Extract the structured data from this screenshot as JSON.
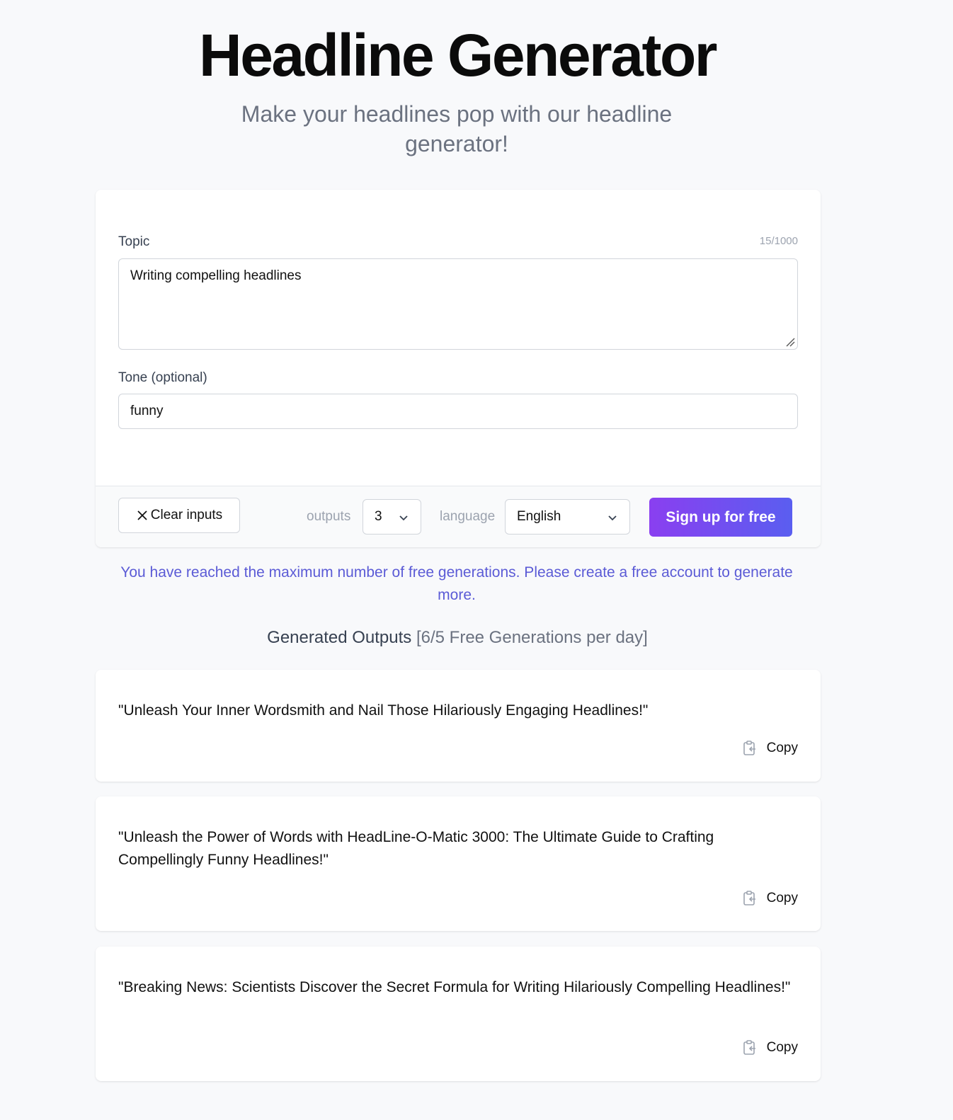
{
  "header": {
    "title": "Headline Generator",
    "subtitle": "Make your headlines pop with our headline generator!"
  },
  "form": {
    "topic_label": "Topic",
    "topic_counter": "15/1000",
    "topic_value": "Writing compelling headlines",
    "tone_label": "Tone (optional)",
    "tone_value": "funny",
    "clear_label": "Clear inputs",
    "outputs_label": "outputs",
    "outputs_value": "3",
    "language_label": "language",
    "language_value": "English",
    "signup_label": "Sign up for free"
  },
  "notice": "You have reached the maximum number of free generations. Please create a free account to generate more.",
  "outputs_section": {
    "heading": "Generated Outputs",
    "quota": "[6/5 Free Generations per day]",
    "copy_label": "Copy",
    "items": [
      "\"Unleash Your Inner Wordsmith and Nail Those Hilariously Engaging Headlines!\"",
      "\"Unleash the Power of Words with HeadLine-O-Matic 3000: The Ultimate Guide to Crafting Compellingly Funny Headlines!\"",
      "\"Breaking News: Scientists Discover the Secret Formula for Writing Hilariously Compelling Headlines!\""
    ]
  },
  "colors": {
    "background": "#f8f9fb",
    "accent_gradient_start": "#8a3ff0",
    "accent_gradient_end": "#5a5ef0",
    "notice_text": "#5b5bd6"
  },
  "icons": {
    "clear": "close-icon",
    "select": "chevron-down-icon",
    "copy": "clipboard-icon",
    "resize": "resize-handle-icon"
  }
}
